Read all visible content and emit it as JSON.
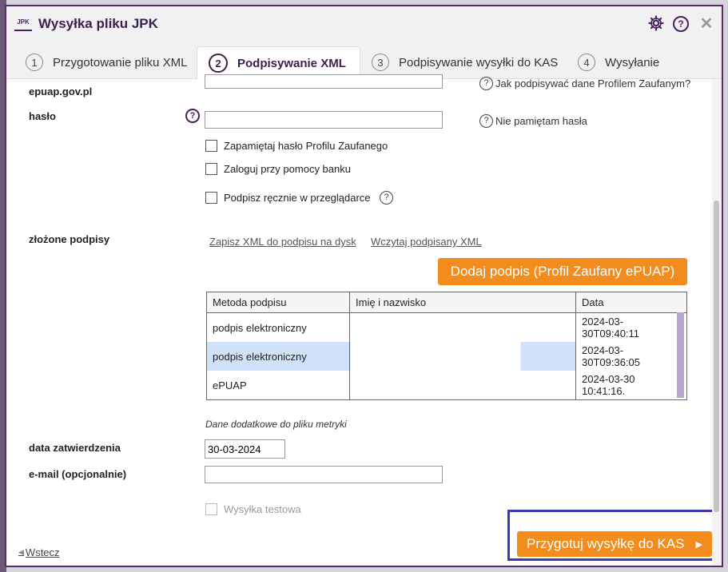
{
  "window": {
    "logo_text": "JPK",
    "title": "Wysyłka pliku JPK"
  },
  "tabs": [
    {
      "num": "1",
      "label": "Przygotowanie pliku XML"
    },
    {
      "num": "2",
      "label": "Podpisywanie XML"
    },
    {
      "num": "3",
      "label": "Podpisywanie wysyłki do KAS"
    },
    {
      "num": "4",
      "label": "Wysyłanie"
    }
  ],
  "form": {
    "epuap_label": "epuap.gov.pl",
    "password_label": "hasło",
    "help_profile": "Jak podpisywać dane Profilem Zaufanym?",
    "forgot_password": "Nie pamiętam hasła",
    "remember_password": "Zapamiętaj hasło Profilu Zaufanego",
    "login_bank": "Zaloguj przy pomocy banku",
    "sign_manual": "Podpisz ręcznie w przeglądarce",
    "signatures_label": "złożone podpisy",
    "save_xml_link": "Zapisz XML do podpisu na dysk",
    "load_xml_link": "Wczytaj podpisany XML",
    "add_signature_button": "Dodaj podpis (Profil Zaufany ePUAP)",
    "metadata_note": "Dane dodatkowe do pliku metryki",
    "approval_date_label": "data zatwierdzenia",
    "approval_date_value": "30-03-2024",
    "email_label": "e-mail (opcjonalnie)",
    "test_send": "Wysyłka testowa"
  },
  "table": {
    "headers": [
      "Metoda podpisu",
      "Imię i nazwisko",
      "Data"
    ],
    "rows": [
      {
        "method": "podpis elektroniczny",
        "name": "",
        "date": "2024-03-30T09:40:11"
      },
      {
        "method": "podpis elektroniczny",
        "name": "",
        "date": "2024-03-30T09:36:05"
      },
      {
        "method": "ePUAP",
        "name": "",
        "date": "2024-03-30 10:41:16."
      }
    ]
  },
  "footer": {
    "back_label": "Wstecz",
    "next_button": "Przygotuj wysyłkę do KAS"
  },
  "colors": {
    "accent": "#f28c1c",
    "brand": "#3c1f4e",
    "selection": "#cfe2f9",
    "highlight": "#3a39b8"
  }
}
